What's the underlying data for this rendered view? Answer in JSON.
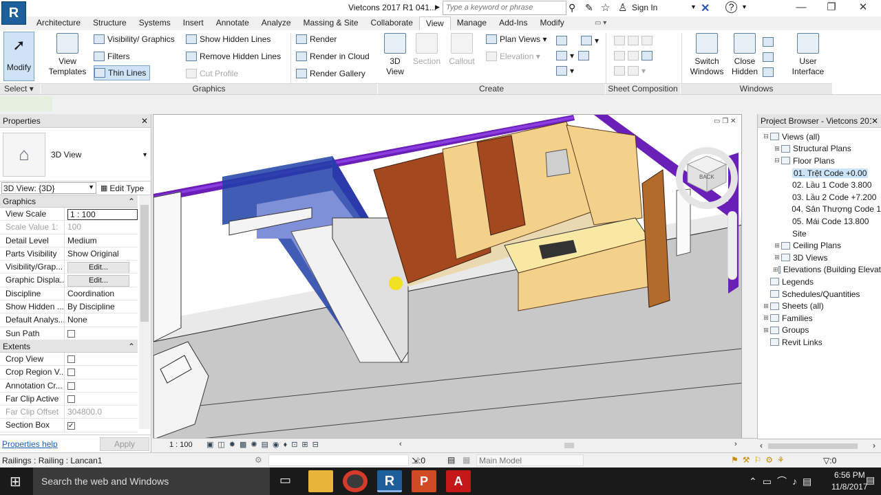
{
  "app": {
    "logo": "R",
    "title": "Vietcons 2017 R1 041...",
    "search_placeholder": "Type a keyword or phrase",
    "sign_in": "Sign In"
  },
  "tabs": [
    {
      "label": "Architecture",
      "active": false
    },
    {
      "label": "Structure",
      "active": false
    },
    {
      "label": "Systems",
      "active": false
    },
    {
      "label": "Insert",
      "active": false
    },
    {
      "label": "Annotate",
      "active": false
    },
    {
      "label": "Analyze",
      "active": false
    },
    {
      "label": "Massing & Site",
      "active": false
    },
    {
      "label": "Collaborate",
      "active": false
    },
    {
      "label": "View",
      "active": true
    },
    {
      "label": "Manage",
      "active": false
    },
    {
      "label": "Add-Ins",
      "active": false
    },
    {
      "label": "Modify",
      "active": false
    }
  ],
  "ribbon": {
    "modify": "Modify",
    "select": "Select",
    "view_templates_1": "View",
    "view_templates_2": "Templates",
    "visibility_graphics": "Visibility/ Graphics",
    "filters": "Filters",
    "thin_lines": "Thin  Lines",
    "show_hidden_lines": "Show  Hidden Lines",
    "remove_hidden_lines": "Remove  Hidden Lines",
    "cut_profile": "Cut  Profile",
    "render": "Render",
    "render_cloud": "Render  in Cloud",
    "render_gallery": "Render  Gallery",
    "three_d_view_1": "3D",
    "three_d_view_2": "View",
    "section": "Section",
    "callout": "Callout",
    "plan_views": "Plan  Views",
    "elevation": "Elevation",
    "switch_windows_1": "Switch",
    "switch_windows_2": "Windows",
    "close_hidden_1": "Close",
    "close_hidden_2": "Hidden",
    "user_interface_1": "User",
    "user_interface_2": "Interface",
    "panel_graphics": "Graphics",
    "panel_create": "Create",
    "panel_sheet": "Sheet Composition",
    "panel_windows": "Windows"
  },
  "properties": {
    "title": "Properties",
    "type_name": "3D View",
    "selector": "3D View: {3D}",
    "edit_type": "Edit Type",
    "section_graphics": "Graphics",
    "section_extents": "Extents",
    "rows_graphics": [
      {
        "k": "View Scale",
        "v": "1 : 100",
        "dim": false,
        "kind": "input"
      },
      {
        "k": "Scale Value    1:",
        "v": "100",
        "dim": true,
        "kind": "text"
      },
      {
        "k": "Detail Level",
        "v": "Medium",
        "dim": false,
        "kind": "text"
      },
      {
        "k": "Parts Visibility",
        "v": "Show Original",
        "dim": false,
        "kind": "text"
      },
      {
        "k": "Visibility/Grap...",
        "v": "Edit...",
        "dim": false,
        "kind": "button"
      },
      {
        "k": "Graphic Displa...",
        "v": "Edit...",
        "dim": false,
        "kind": "button"
      },
      {
        "k": "Discipline",
        "v": "Coordination",
        "dim": false,
        "kind": "text"
      },
      {
        "k": "Show Hidden ...",
        "v": "By Discipline",
        "dim": false,
        "kind": "text"
      },
      {
        "k": "Default Analys...",
        "v": "None",
        "dim": false,
        "kind": "text"
      },
      {
        "k": "Sun Path",
        "v": "",
        "dim": false,
        "kind": "check",
        "checked": false
      }
    ],
    "rows_extents": [
      {
        "k": "Crop View",
        "v": "",
        "dim": false,
        "kind": "check",
        "checked": false
      },
      {
        "k": "Crop Region V...",
        "v": "",
        "dim": false,
        "kind": "check",
        "checked": false
      },
      {
        "k": "Annotation Cr...",
        "v": "",
        "dim": false,
        "kind": "check",
        "checked": false
      },
      {
        "k": "Far Clip Active",
        "v": "",
        "dim": false,
        "kind": "check",
        "checked": false
      },
      {
        "k": "Far Clip Offset",
        "v": "304800.0",
        "dim": true,
        "kind": "text"
      },
      {
        "k": "Section Box",
        "v": "",
        "dim": false,
        "kind": "check",
        "checked": true
      }
    ],
    "help": "Properties help",
    "apply": "Apply"
  },
  "viewport": {
    "scale": "1 : 100",
    "viewcube_label": "BACK"
  },
  "browser": {
    "title": "Project Browser - Vietcons 201...",
    "items": [
      {
        "label": "Views (all)",
        "level": 0,
        "tw": "−",
        "selected": false
      },
      {
        "label": "Structural Plans",
        "level": 1,
        "tw": "+",
        "selected": false
      },
      {
        "label": "Floor Plans",
        "level": 1,
        "tw": "−",
        "selected": false
      },
      {
        "label": "01. Trệt Code +0.00",
        "level": 2,
        "tw": "",
        "selected": true
      },
      {
        "label": "02. Lầu 1 Code 3.800",
        "level": 2,
        "tw": "",
        "selected": false
      },
      {
        "label": "03. Lầu 2 Code +7.200",
        "level": 2,
        "tw": "",
        "selected": false
      },
      {
        "label": "04. Sân Thượng Code 1",
        "level": 2,
        "tw": "",
        "selected": false
      },
      {
        "label": "05. Mái Code 13.800",
        "level": 2,
        "tw": "",
        "selected": false
      },
      {
        "label": "Site",
        "level": 2,
        "tw": "",
        "selected": false
      },
      {
        "label": "Ceiling Plans",
        "level": 1,
        "tw": "+",
        "selected": false
      },
      {
        "label": "3D Views",
        "level": 1,
        "tw": "+",
        "selected": false
      },
      {
        "label": "Elevations (Building Elevat",
        "level": 1,
        "tw": "+",
        "selected": false
      },
      {
        "label": "Legends",
        "level": 0,
        "tw": "",
        "selected": false
      },
      {
        "label": "Schedules/Quantities",
        "level": 0,
        "tw": "",
        "selected": false
      },
      {
        "label": "Sheets (all)",
        "level": 0,
        "tw": "+",
        "selected": false
      },
      {
        "label": "Families",
        "level": 0,
        "tw": "+",
        "selected": false
      },
      {
        "label": "Groups",
        "level": 0,
        "tw": "+",
        "selected": false
      },
      {
        "label": "Revit Links",
        "level": 0,
        "tw": "",
        "selected": false
      }
    ]
  },
  "status": {
    "selection": "Railings : Railing : Lancan1",
    "count": ":0",
    "model": "Main Model",
    "filter_count": ":0"
  },
  "taskbar": {
    "search": "Search the web and Windows",
    "time": "6:56 PM",
    "date": "11/8/2017"
  }
}
